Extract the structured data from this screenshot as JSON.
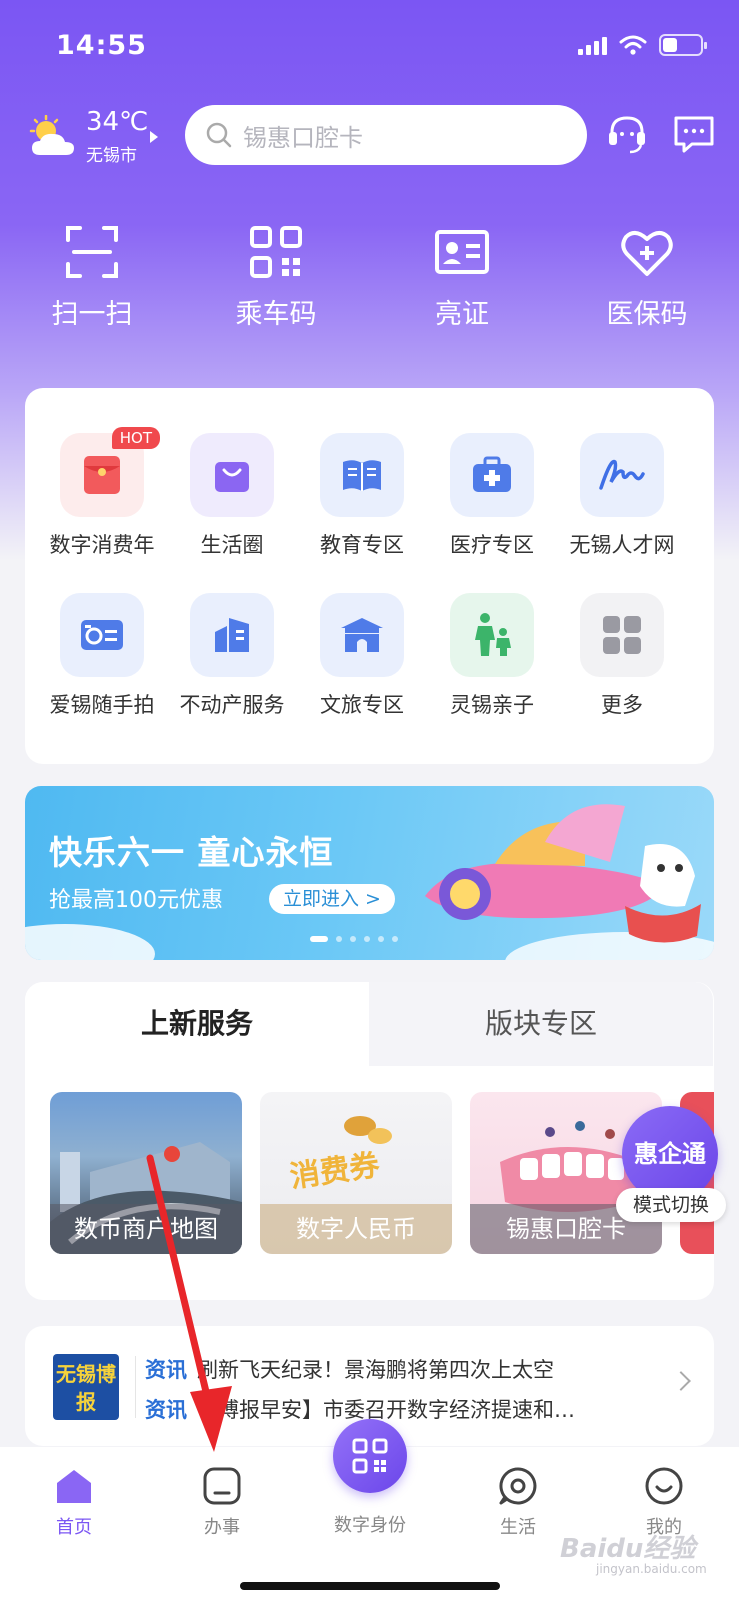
{
  "status_bar": {
    "time": "14:55"
  },
  "topbar": {
    "temperature": "34℃",
    "city": "无锡市",
    "search_placeholder": "锡惠口腔卡",
    "icons": [
      "weather-sun-cloud-icon",
      "search-icon",
      "customer-service-icon",
      "message-icon"
    ]
  },
  "quick_actions": [
    {
      "label": "扫一扫",
      "icon": "scan-icon"
    },
    {
      "label": "乘车码",
      "icon": "qr-code-icon"
    },
    {
      "label": "亮证",
      "icon": "id-card-icon"
    },
    {
      "label": "医保码",
      "icon": "heart-plus-icon"
    }
  ],
  "service_grid": [
    {
      "label": "数字消费年",
      "icon": "red-envelope-icon",
      "badge": "HOT"
    },
    {
      "label": "生活圈",
      "icon": "shopping-bag-icon"
    },
    {
      "label": "教育专区",
      "icon": "book-icon"
    },
    {
      "label": "医疗专区",
      "icon": "medical-kit-icon"
    },
    {
      "label": "无锡人才网",
      "icon": "signature-icon"
    },
    {
      "label": "爱锡随手拍",
      "icon": "camera-icon"
    },
    {
      "label": "不动产服务",
      "icon": "building-icon"
    },
    {
      "label": "文旅专区",
      "icon": "pavilion-icon"
    },
    {
      "label": "灵锡亲子",
      "icon": "parent-child-icon"
    },
    {
      "label": "更多",
      "icon": "grid-more-icon"
    }
  ],
  "banner": {
    "title": "快乐六一 童心永恒",
    "subtitle": "抢最高100元优惠",
    "button": "立即进入 >"
  },
  "services_section": {
    "tabs": [
      "上新服务",
      "版块专区"
    ],
    "tiles": [
      "数币商户地图",
      "数字人民币",
      "锡惠口腔卡"
    ],
    "coupon_art": "消费券"
  },
  "float_badge": {
    "title": "惠企通",
    "pill": "模式切换"
  },
  "news": {
    "logo": "无锡博报",
    "items": [
      {
        "tag": "资讯",
        "text": "刷新飞天纪录！景海鹏将第四次上太空"
      },
      {
        "tag": "资讯",
        "text": "【博报早安】市委召开数字经济提速和…"
      }
    ]
  },
  "tabbar": {
    "items": [
      {
        "label": "首页",
        "icon": "home-icon",
        "active": true
      },
      {
        "label": "办事",
        "icon": "tasks-icon",
        "active": false
      },
      {
        "label": "数字身份",
        "icon": "qr-code-icon",
        "active": false
      },
      {
        "label": "生活",
        "icon": "life-icon",
        "active": false
      },
      {
        "label": "我的",
        "icon": "profile-icon",
        "active": false
      }
    ]
  },
  "watermark": {
    "brand": "Baidu经验",
    "url": "jingyan.baidu.com"
  },
  "colors": {
    "accent": "#7b56f3",
    "hot": "#f0494d",
    "link": "#2a6fd6",
    "annotation_arrow": "#e8262a"
  }
}
